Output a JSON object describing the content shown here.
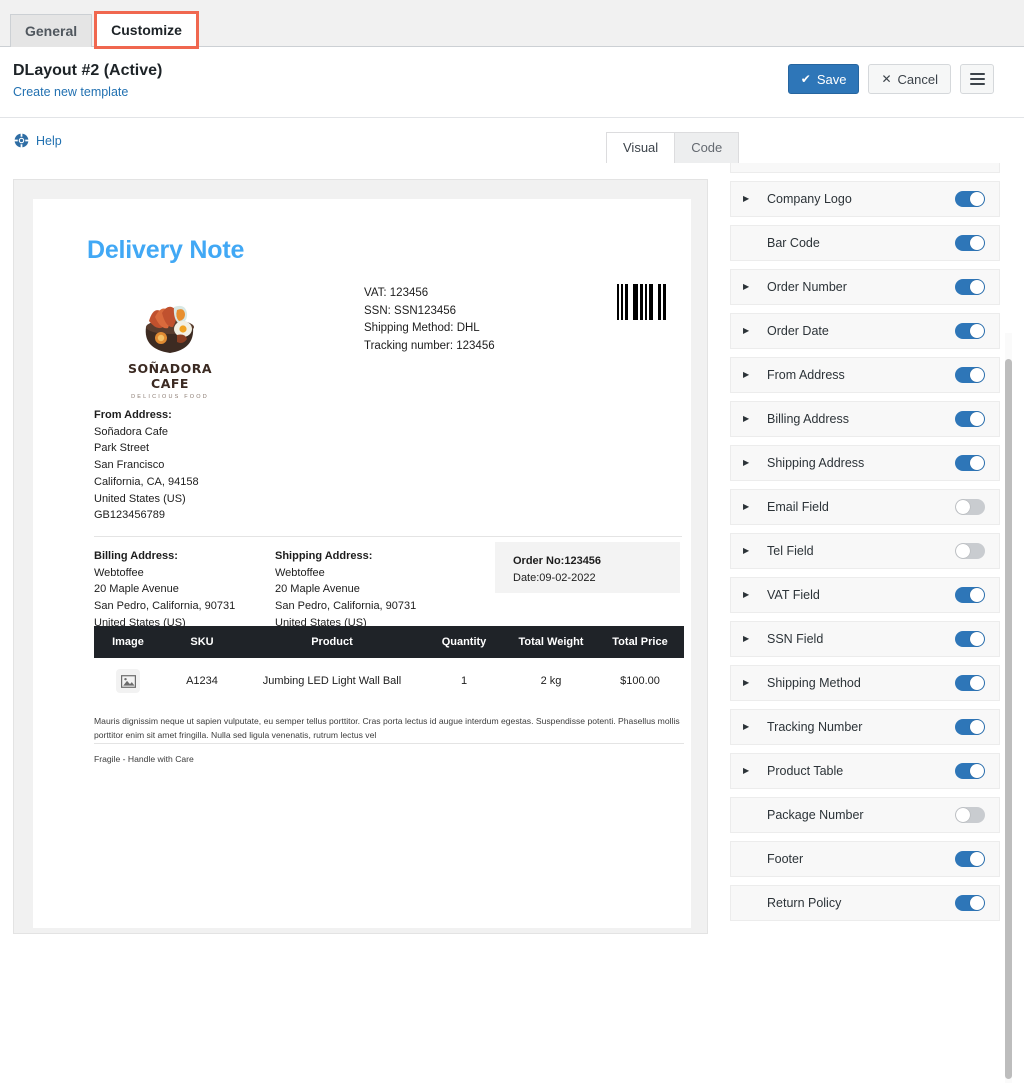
{
  "tabs": [
    {
      "label": "General",
      "active": false,
      "focused": false
    },
    {
      "label": "Customize",
      "active": true,
      "focused": true
    }
  ],
  "header": {
    "title": "DLayout #2 (Active)",
    "create_link": "Create new template",
    "save_label": "Save",
    "save_icon": "check-icon",
    "cancel_label": "Cancel",
    "cancel_icon": "close-icon",
    "menu_icon": "hamburger-icon",
    "accent_color": "#2e76b8"
  },
  "subbar": {
    "help_label": "Help",
    "help_icon": "lifebuoy-icon",
    "editor_tabs": [
      {
        "label": "Visual",
        "active": true
      },
      {
        "label": "Code",
        "active": false
      }
    ]
  },
  "document": {
    "title": "Delivery Note",
    "title_color": "#41a8f5",
    "logo": {
      "name": "SOÑADORA CAFE",
      "tagline": "DELICIOUS FOOD",
      "icon": "cafe-food-logo"
    },
    "meta": [
      "VAT: 123456",
      "SSN: SSN123456",
      "Shipping Method: DHL",
      "Tracking number: 123456"
    ],
    "barcode_label": "barcode-icon",
    "from_address": {
      "heading": "From Address:",
      "lines": [
        "Soñadora Cafe",
        "Park Street",
        "San Francisco",
        "California, CA, 94158",
        "United States (US)",
        "GB123456789"
      ]
    },
    "billing_address": {
      "heading": "Billing Address:",
      "lines": [
        "Webtoffee",
        "20 Maple Avenue",
        "San Pedro, California, 90731",
        "United States (US)"
      ]
    },
    "shipping_address": {
      "heading": "Shipping Address:",
      "lines": [
        "Webtoffee",
        "20 Maple Avenue",
        "San Pedro, California, 90731",
        "United States (US)"
      ]
    },
    "order_box": {
      "order_no": "Order No:123456",
      "date": "Date:09-02-2022"
    },
    "product_table": {
      "columns": [
        "Image",
        "SKU",
        "Product",
        "Quantity",
        "Total Weight",
        "Total Price"
      ],
      "rows": [
        {
          "image": "image-placeholder-icon",
          "sku": "A1234",
          "product": "Jumbing LED Light Wall Ball",
          "quantity": "1",
          "total_weight": "2 kg",
          "total_price": "$100.00"
        }
      ]
    },
    "footer_text": "Mauris dignissim neque ut sapien vulputate, eu semper tellus porttitor. Cras porta lectus id augue interdum egestas. Suspendisse potenti. Phasellus mollis porttitor enim sit amet fringilla. Nulla sed ligula venenatis, rutrum lectus vel",
    "return_policy_text": "Fragile - Handle with Care"
  },
  "settings_panel": {
    "items": [
      {
        "label": "",
        "expandable": false,
        "enabled": true,
        "partial": true
      },
      {
        "label": "Company Logo",
        "expandable": true,
        "enabled": true
      },
      {
        "label": "Bar Code",
        "expandable": false,
        "enabled": true
      },
      {
        "label": "Order Number",
        "expandable": true,
        "enabled": true
      },
      {
        "label": "Order Date",
        "expandable": true,
        "enabled": true
      },
      {
        "label": "From Address",
        "expandable": true,
        "enabled": true
      },
      {
        "label": "Billing Address",
        "expandable": true,
        "enabled": true
      },
      {
        "label": "Shipping Address",
        "expandable": true,
        "enabled": true
      },
      {
        "label": "Email Field",
        "expandable": true,
        "enabled": false
      },
      {
        "label": "Tel Field",
        "expandable": true,
        "enabled": false
      },
      {
        "label": "VAT Field",
        "expandable": true,
        "enabled": true
      },
      {
        "label": "SSN Field",
        "expandable": true,
        "enabled": true
      },
      {
        "label": "Shipping Method",
        "expandable": true,
        "enabled": true
      },
      {
        "label": "Tracking Number",
        "expandable": true,
        "enabled": true
      },
      {
        "label": "Product Table",
        "expandable": true,
        "enabled": true
      },
      {
        "label": "Package Number",
        "expandable": false,
        "enabled": false
      },
      {
        "label": "Footer",
        "expandable": false,
        "enabled": true
      },
      {
        "label": "Return Policy",
        "expandable": false,
        "enabled": true
      }
    ],
    "toggle_on_color": "#2e76b8",
    "toggle_off_color": "#c9ccd0"
  }
}
